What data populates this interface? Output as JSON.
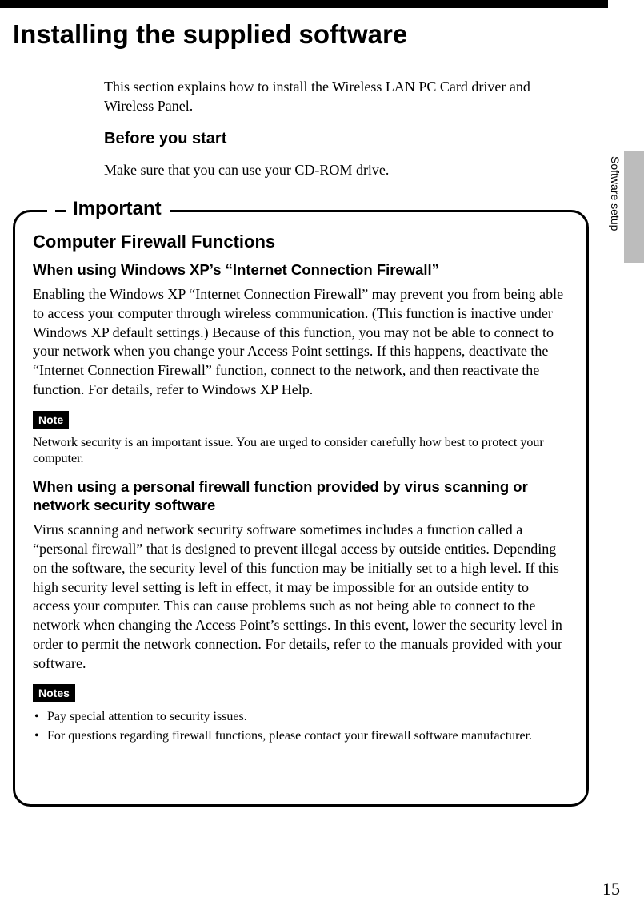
{
  "header": {
    "title": "Installing the supplied software"
  },
  "intro": "This section explains how to install the Wireless LAN PC Card driver and Wireless Panel.",
  "before": {
    "heading": "Before you start",
    "text": "Make sure that you can use your CD-ROM drive."
  },
  "sideTab": "Software setup",
  "important": {
    "label": "Important",
    "firewallHeading": "Computer Firewall Functions",
    "xpHeading": "When using Windows XP’s “Internet Connection Firewall”",
    "xpPara": "Enabling the Windows XP “Internet Connection Firewall” may prevent you from being able to access your computer through wireless communication. (This function is inactive under Windows XP default settings.) Because of this function, you may not be able to connect to your network when you change your Access Point settings. If this happens, deactivate the “Internet Connection Firewall” function, connect to the network, and then reactivate the function. For details, refer to Windows XP Help.",
    "noteBadge": "Note",
    "noteText": "Network security is an important issue. You are urged to consider carefully how best to protect your computer.",
    "personalHeading": "When using a personal firewall function provided by virus scanning or network security software",
    "personalPara": "Virus scanning and network security software sometimes includes a function called a “personal firewall” that is designed to prevent illegal access by outside entities. Depending on the software, the security level of this function may be initially set to a high level. If this high security level setting is left in effect, it may be impossible for an outside entity to access your computer. This can cause problems such as not being able to connect to the network when changing the Access Point’s settings. In this event, lower the security level in order to permit the network connection. For details, refer to the manuals provided with your software.",
    "notesBadge": "Notes",
    "notesList": [
      "Pay special attention to security issues.",
      "For questions regarding firewall functions, please contact your firewall software manufacturer."
    ]
  },
  "pageNumber": "15"
}
